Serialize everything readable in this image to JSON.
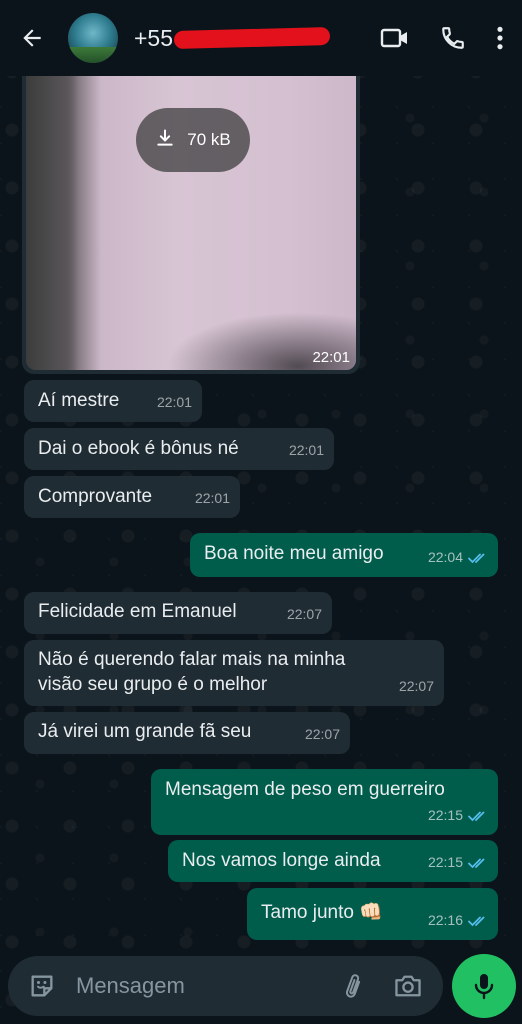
{
  "header": {
    "contact_prefix": "+55",
    "icons": [
      "back-arrow-icon",
      "avatar",
      "video-call-icon",
      "phone-icon",
      "more-vert-icon"
    ]
  },
  "media": {
    "download_size": "70 kB",
    "time": "22:01",
    "icon": "download-icon"
  },
  "messages": [
    {
      "dir": "in",
      "text": "Aí mestre",
      "time": "22:01"
    },
    {
      "dir": "in",
      "text": "Dai o ebook é bônus né",
      "time": "22:01"
    },
    {
      "dir": "in",
      "text": "Comprovante",
      "time": "22:01"
    },
    {
      "dir": "out",
      "text": "Boa noite meu amigo",
      "time": "22:04",
      "status": "read"
    },
    {
      "dir": "in",
      "text": "Felicidade em Emanuel",
      "time": "22:07"
    },
    {
      "dir": "in",
      "text": "Não é querendo falar mais na minha\nvisão seu grupo é o melhor",
      "time": "22:07"
    },
    {
      "dir": "in",
      "text": "Já virei um grande fã seu",
      "time": "22:07"
    },
    {
      "dir": "out",
      "text": "Mensagem de peso em guerreiro",
      "time": "22:15",
      "status": "read"
    },
    {
      "dir": "out",
      "text": "Nos vamos longe ainda",
      "time": "22:15",
      "status": "read"
    },
    {
      "dir": "out",
      "text": "Tamo junto 👊🏻",
      "time": "22:16",
      "status": "read"
    }
  ],
  "composer": {
    "placeholder": "Mensagem",
    "icons": [
      "sticker-icon",
      "attach-icon",
      "camera-icon",
      "mic-icon"
    ]
  },
  "colors": {
    "background": "#0b141a",
    "incoming_bubble": "#202c33",
    "outgoing_bubble": "#005c4b",
    "read_ticks": "#53bdeb",
    "mic_button": "#21c063"
  }
}
